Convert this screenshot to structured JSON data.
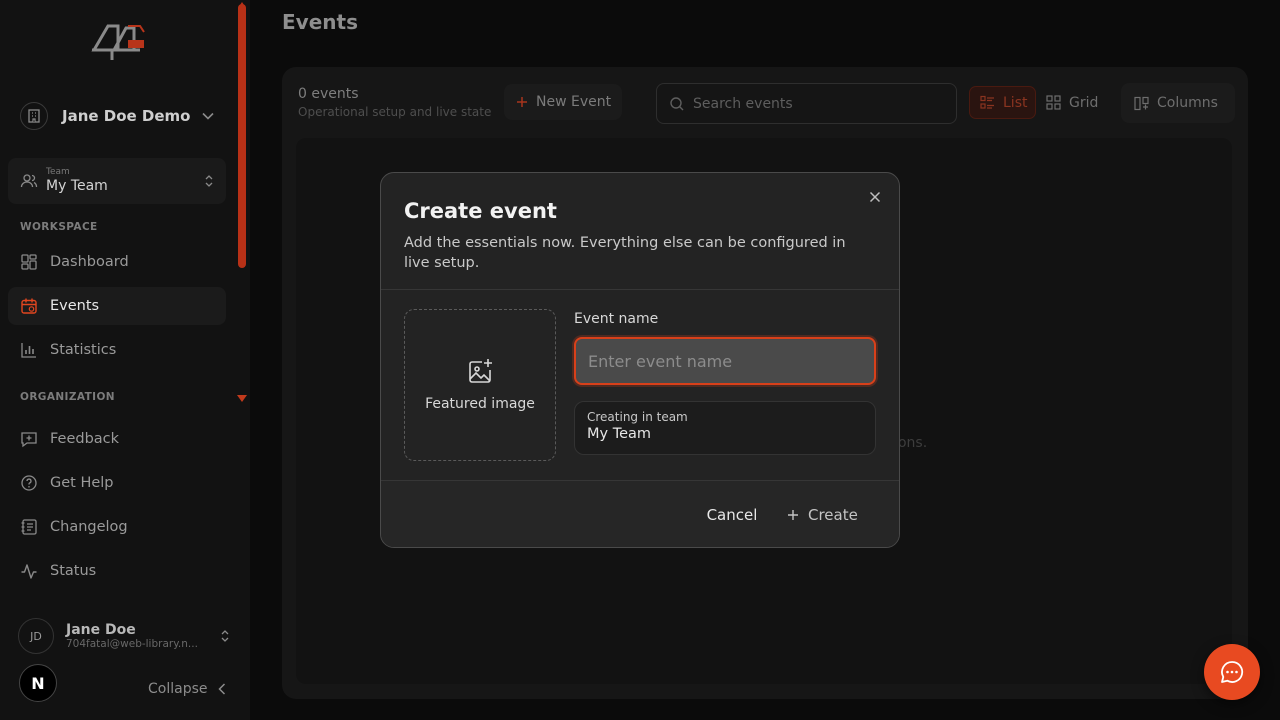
{
  "sidebar": {
    "account_name": "Jane Doe Demo",
    "team_caption": "Team",
    "team_value": "My Team",
    "workspace_label": "WORKSPACE",
    "organization_label": "ORGANIZATION",
    "workspace_items": [
      {
        "label": "Dashboard",
        "icon": "dashboard-icon"
      },
      {
        "label": "Events",
        "icon": "calendar-icon",
        "active": true
      },
      {
        "label": "Statistics",
        "icon": "chart-bars-icon"
      }
    ],
    "organization_items": [
      {
        "label": "Feedback",
        "icon": "feedback-icon"
      },
      {
        "label": "Get Help",
        "icon": "help-circle-icon"
      },
      {
        "label": "Changelog",
        "icon": "changelog-icon"
      },
      {
        "label": "Status",
        "icon": "activity-icon"
      }
    ],
    "user": {
      "initials": "JD",
      "name": "Jane Doe",
      "email": "704fatal@web-library.n..."
    },
    "badge_letter": "N",
    "collapse_label": "Collapse"
  },
  "main": {
    "title": "Events",
    "count_label": "0 events",
    "subtitle": "Operational setup and live state",
    "new_event_label": "New Event",
    "search_placeholder": "Search events",
    "view_list_label": "List",
    "view_grid_label": "Grid",
    "columns_label": "Columns",
    "empty_hint": "ations."
  },
  "modal": {
    "title": "Create event",
    "description": "Add the essentials now. Everything else can be configured in live setup.",
    "featured_image_label": "Featured image",
    "event_name_label": "Event name",
    "event_name_placeholder": "Enter event name",
    "event_name_value": "",
    "team_caption": "Creating in team",
    "team_value": "My Team",
    "cancel_label": "Cancel",
    "create_label": "Create"
  },
  "colors": {
    "accent": "#e84a21",
    "background": "#0b0b0b",
    "sidebar": "#121212",
    "modal": "#232323"
  }
}
